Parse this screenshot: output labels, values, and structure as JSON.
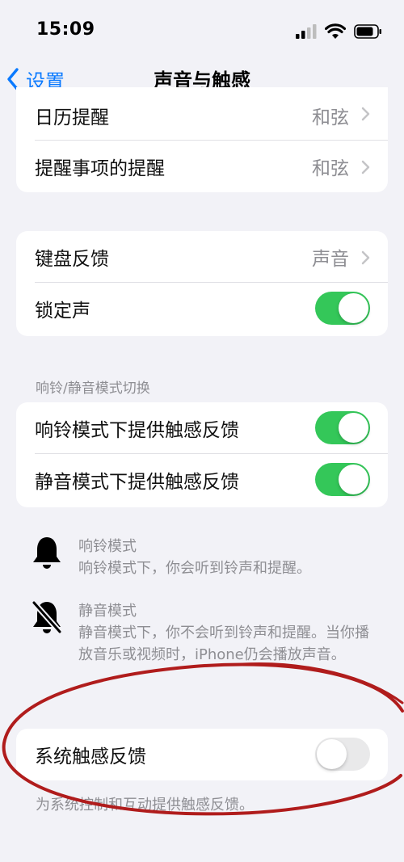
{
  "status_bar": {
    "time": "15:09"
  },
  "nav": {
    "back_label": "设置",
    "title": "声音与触感"
  },
  "alerts_group": [
    {
      "label": "日历提醒",
      "value": "和弦"
    },
    {
      "label": "提醒事项的提醒",
      "value": "和弦"
    }
  ],
  "keyboard_group": {
    "keyboard_feedback": {
      "label": "键盘反馈",
      "value": "声音"
    },
    "lock_sound": {
      "label": "锁定声",
      "enabled": true
    }
  },
  "ring_silent": {
    "header": "响铃/静音模式切换",
    "ring_haptics": {
      "label": "响铃模式下提供触感反馈",
      "enabled": true
    },
    "silent_haptics": {
      "label": "静音模式下提供触感反馈",
      "enabled": true
    }
  },
  "modes": {
    "ring": {
      "title": "响铃模式",
      "desc": "响铃模式下，你会听到铃声和提醒。"
    },
    "silent": {
      "title": "静音模式",
      "desc": "静音模式下，你不会听到铃声和提醒。当你播放音乐或视频时，iPhone仍会播放声音。"
    }
  },
  "system_haptics": {
    "label": "系统触感反馈",
    "enabled": false,
    "footer": "为系统控制和互动提供触感反馈。"
  },
  "colors": {
    "accent": "#0a7aff",
    "toggle_on": "#34c759",
    "annotation": "#b01c1c"
  }
}
